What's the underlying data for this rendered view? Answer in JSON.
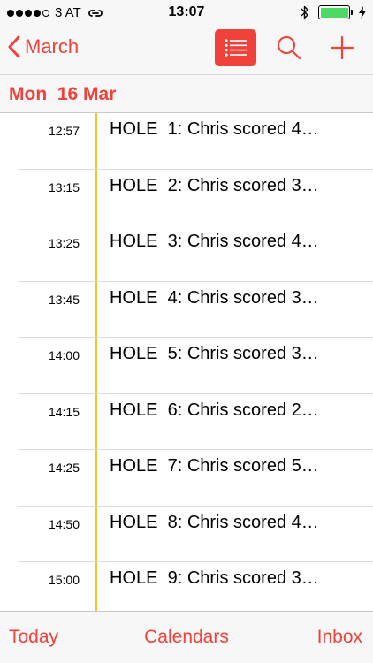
{
  "status_bar": {
    "carrier": "3 AT",
    "time": "13:07",
    "signal_dots_filled": 4,
    "signal_dots_total": 5,
    "battery_level": 1.0,
    "icons": [
      "wifi-link-icon",
      "bluetooth-icon",
      "battery-icon",
      "charging-icon"
    ]
  },
  "nav": {
    "back_label": "March",
    "buttons": [
      "list-view-icon",
      "search-icon",
      "add-icon"
    ]
  },
  "date_header": {
    "text": "Mon  16 Mar"
  },
  "events": [
    {
      "time": "12:57",
      "title": "HOLE  1: Chris scored 4…"
    },
    {
      "time": "13:15",
      "title": "HOLE  2: Chris scored 3…"
    },
    {
      "time": "13:25",
      "title": "HOLE  3: Chris scored 4…"
    },
    {
      "time": "13:45",
      "title": "HOLE  4: Chris scored 3…"
    },
    {
      "time": "14:00",
      "title": "HOLE  5: Chris scored 3…"
    },
    {
      "time": "14:15",
      "title": "HOLE  6: Chris scored 2…"
    },
    {
      "time": "14:25",
      "title": "HOLE  7: Chris scored 5…"
    },
    {
      "time": "14:50",
      "title": "HOLE  8: Chris scored 4…"
    },
    {
      "time": "15:00",
      "title": "HOLE  9: Chris scored 3…"
    }
  ],
  "tabbar": {
    "today": "Today",
    "calendars": "Calendars",
    "inbox": "Inbox"
  },
  "colors": {
    "accent": "#f0413a",
    "event_bar": "#f5c623",
    "battery": "#4cd964"
  }
}
